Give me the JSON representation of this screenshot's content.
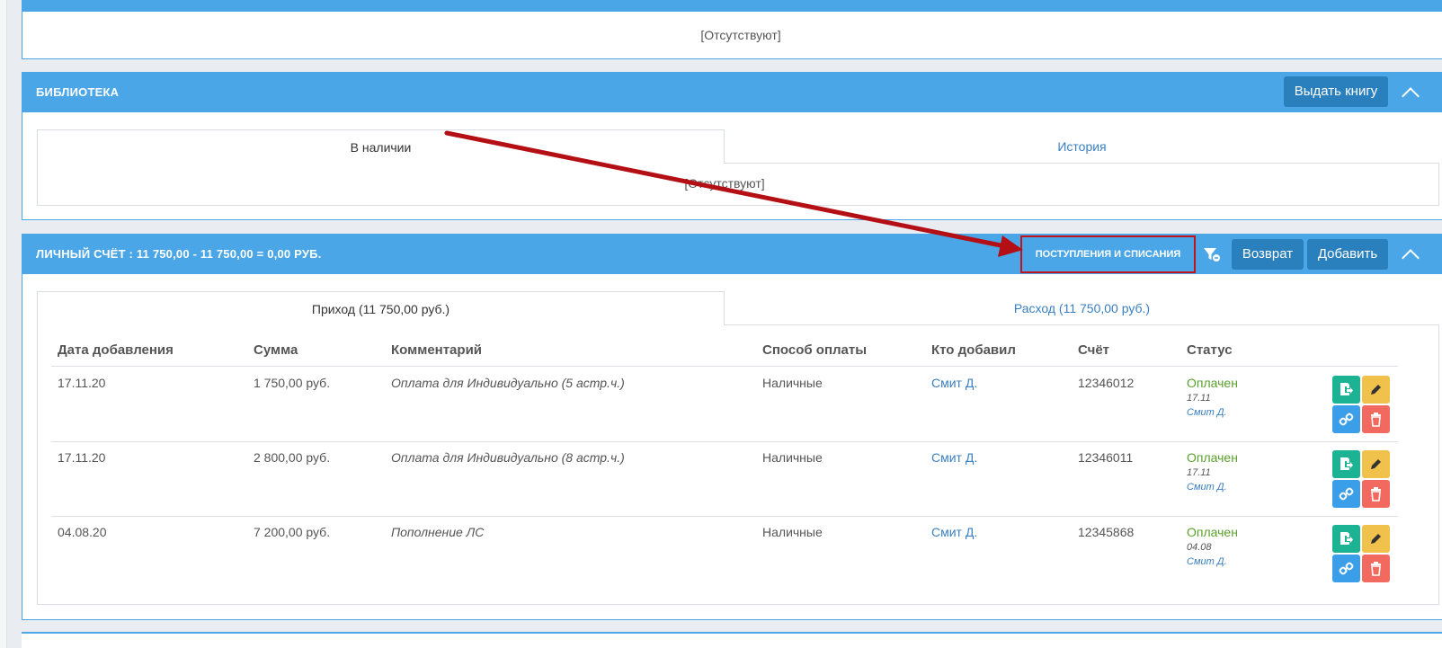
{
  "top_panel": {
    "empty_text": "[Отсутствуют]"
  },
  "library": {
    "title": "Библиотека",
    "issue_button": "Выдать книгу",
    "tabs": [
      {
        "label": "В наличии"
      },
      {
        "label": "История"
      }
    ],
    "empty_text": "[Отсутствуют]"
  },
  "account": {
    "title": "Личный счёт :  11 750,00 - 11 750,00 = 0,00 руб.",
    "income_button": "Поступления и списания",
    "return_button": "Возврат",
    "add_button": "Добавить",
    "tabs": [
      {
        "label": "Приход (11 750,00 руб.)"
      },
      {
        "label": "Расход (11 750,00 руб.)"
      }
    ],
    "columns": [
      "Дата добавления",
      "Сумма",
      "Комментарий",
      "Способ оплаты",
      "Кто добавил",
      "Счёт",
      "Статус"
    ],
    "rows": [
      {
        "date": "17.11.20",
        "amount": "1 750,00 руб.",
        "comment": "Оплата для Индивидуально (5 астр.ч.)",
        "method": "Наличные",
        "author": "Смит Д.",
        "invoice": "12346012",
        "status": "Оплачен",
        "status_date": "17.11",
        "status_author": "Смит Д."
      },
      {
        "date": "17.11.20",
        "amount": "2 800,00 руб.",
        "comment": "Оплата для Индивидуально (8 астр.ч.)",
        "method": "Наличные",
        "author": "Смит Д.",
        "invoice": "12346011",
        "status": "Оплачен",
        "status_date": "17.11",
        "status_author": "Смит Д."
      },
      {
        "date": "04.08.20",
        "amount": "7 200,00 руб.",
        "comment": "Пополнение ЛС",
        "method": "Наличные",
        "author": "Смит Д.",
        "invoice": "12345868",
        "status": "Оплачен",
        "status_date": "04.08",
        "status_author": "Смит Д."
      }
    ]
  },
  "colors": {
    "panel_header": "#4aa6e6",
    "dark_button": "#2a7fbd",
    "highlight": "#c0141b",
    "paid_status": "#5aa02c",
    "link": "#3a7fc1"
  },
  "icons": [
    "filter-icon",
    "receipt-export-icon",
    "pencil-icon",
    "link-icon",
    "trash-icon",
    "chevron-up-icon"
  ]
}
